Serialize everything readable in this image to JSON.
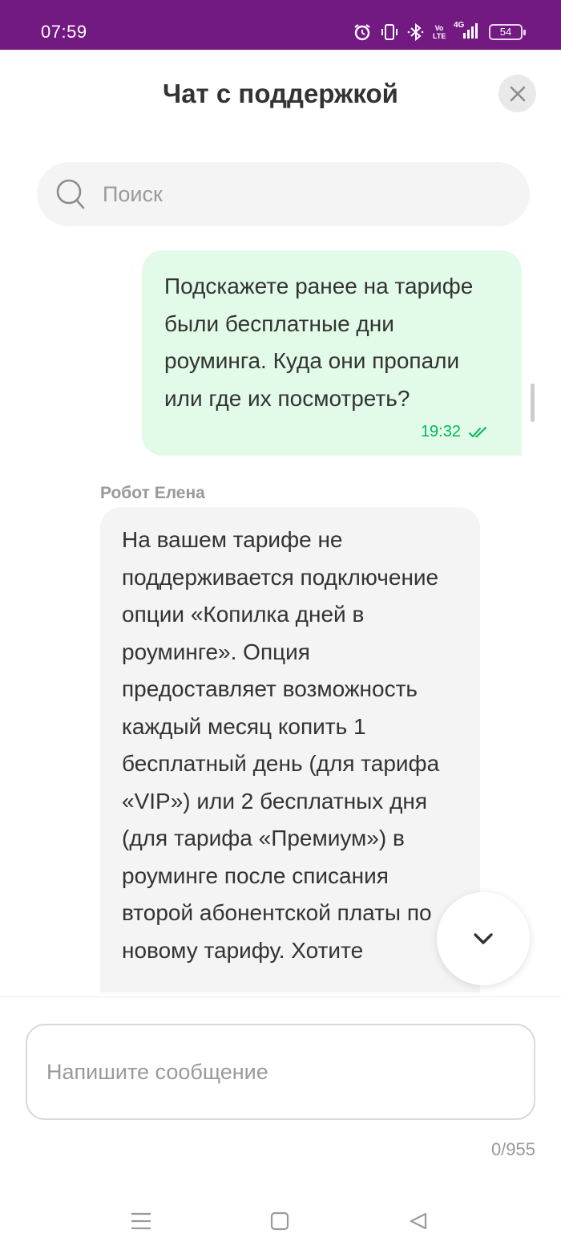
{
  "status_bar": {
    "time": "07:59",
    "icons": [
      "alarm-icon",
      "vibrate-icon",
      "bluetooth-icon",
      "volte-icon",
      "signal-4g-icon",
      "battery-icon"
    ],
    "volte_label": "Vo LTE",
    "network_label": "4G",
    "battery_level": "54",
    "background_color": "#731982"
  },
  "header": {
    "title": "Чат с поддержкой",
    "close_icon": "close-icon"
  },
  "search": {
    "placeholder": "Поиск",
    "icon": "search-icon"
  },
  "messages": [
    {
      "direction": "outgoing",
      "text": "Подскажете ранее на тарифе были бесплатные дни роуминга. Куда они пропали или где их посмотреть?",
      "time": "19:32",
      "status": "read"
    },
    {
      "direction": "incoming",
      "sender": "Робот Елена",
      "text": "На вашем тарифе не поддерживается подключение опции «Копилка дней в роуминге». Опция предоставляет возможность каждый месяц копить 1 бесплатный день (для тарифа «VIP») или 2 бесплатных дня (для тарифа «Премиум») в роуминге после списания второй абонентской платы по новому тарифу. Хотите"
    }
  ],
  "scroll_down_icon": "chevron-down-icon",
  "composer": {
    "placeholder": "Напишите сообщение",
    "counter": "0/955"
  },
  "colors": {
    "accent": "#731982",
    "outgoing_bubble": "#e2fbe9",
    "incoming_bubble": "#f4f4f4",
    "read_status": "#00b956"
  },
  "navbar": {
    "icons": [
      "menu-icon",
      "home-icon",
      "back-icon"
    ]
  }
}
